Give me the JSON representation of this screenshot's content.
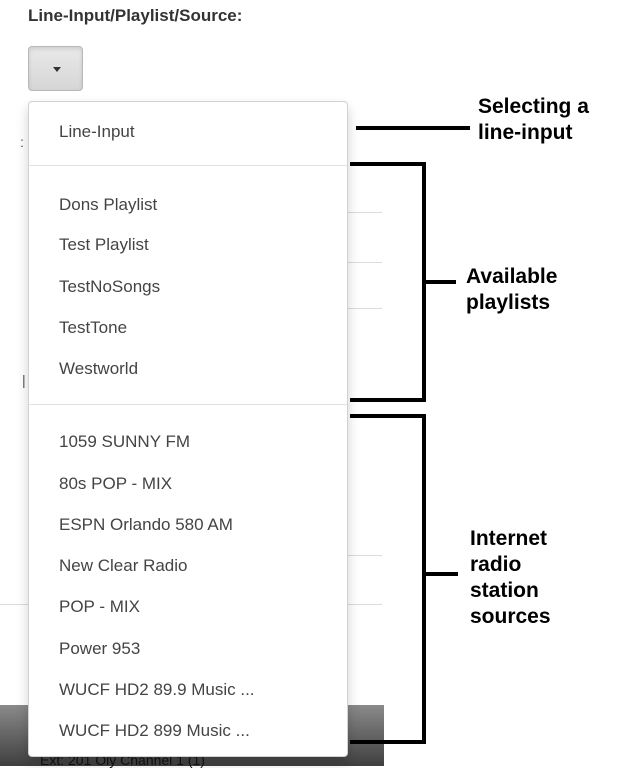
{
  "header": {
    "label": "Line-Input/Playlist/Source:"
  },
  "background": {
    "bar_text": "Ext: 201 Oly Channel 1 (1)"
  },
  "menu": {
    "line_input": "Line-Input",
    "playlists": [
      "Dons Playlist",
      "Test Playlist",
      "TestNoSongs",
      "TestTone",
      "Westworld"
    ],
    "sources": [
      "1059 SUNNY FM",
      "80s POP - MIX",
      "ESPN Orlando 580 AM",
      "New Clear Radio",
      "POP - MIX",
      "Power 953",
      "WUCF HD2 89.9 Music ...",
      "WUCF HD2 899 Music ..."
    ]
  },
  "annotations": {
    "line_input": [
      "Selecting a",
      "line-input"
    ],
    "playlists": [
      "Available",
      "playlists"
    ],
    "sources": [
      "Internet",
      "radio",
      "station",
      "sources"
    ]
  }
}
